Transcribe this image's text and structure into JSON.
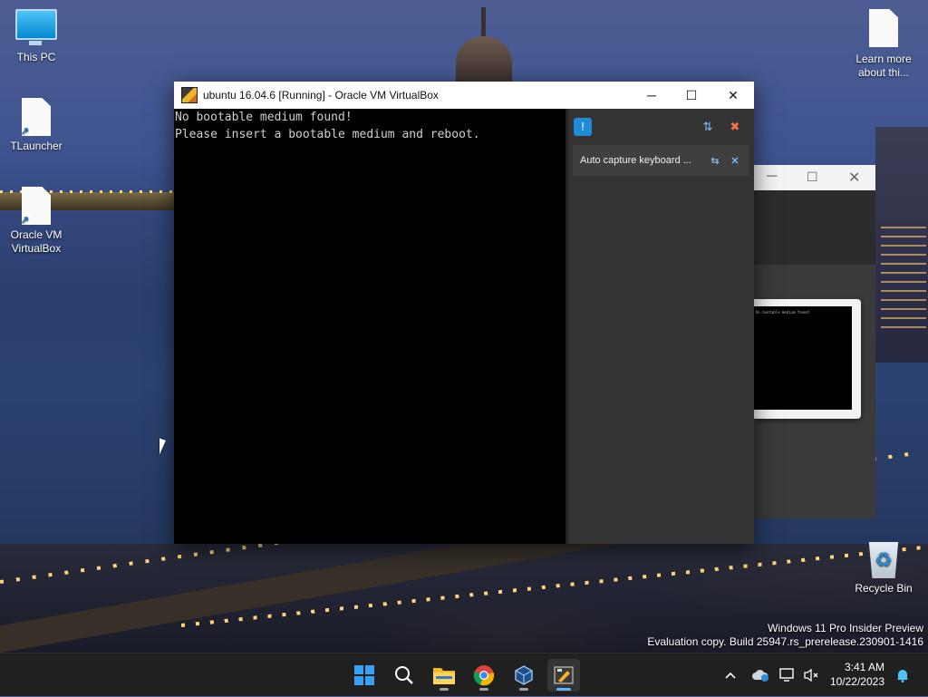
{
  "desktop": {
    "icons": [
      {
        "label": "This PC",
        "icon": "monitor-icon"
      },
      {
        "label": "TLauncher",
        "icon": "file-shortcut-icon"
      },
      {
        "label": "Oracle VM VirtualBox",
        "icon": "file-shortcut-icon"
      },
      {
        "label": "Learn more about thi...",
        "icon": "file-icon"
      },
      {
        "label": "Recycle Bin",
        "icon": "recycle-bin-icon"
      }
    ],
    "watermark": {
      "line1": "Windows 11 Pro Insider Preview",
      "line2": "Evaluation copy. Build 25947.rs_prerelease.230901-1416"
    }
  },
  "vbox_window": {
    "title": "ubuntu 16.04.6 [Running] - Oracle VM VirtualBox",
    "controls": {
      "minimize": "─",
      "maximize": "☐",
      "close": "✕"
    },
    "console_lines": [
      "No bootable medium found!",
      "Please insert a bootable medium and reboot."
    ],
    "notification": {
      "text": "Auto capture keyboard ...",
      "icons": [
        "pin-icon",
        "close-icon"
      ]
    }
  },
  "back_window": {
    "controls": {
      "minimize": "─",
      "maximize": "☐",
      "close": "✕"
    },
    "thumb_text": "No bootable medium found!"
  },
  "taskbar": {
    "apps": [
      {
        "name": "start-button",
        "icon": "windows-logo-icon"
      },
      {
        "name": "search-button",
        "icon": "search-icon"
      },
      {
        "name": "file-explorer",
        "icon": "folder-icon"
      },
      {
        "name": "chrome",
        "icon": "chrome-icon"
      },
      {
        "name": "virtualbox-manager",
        "icon": "virtualbox-icon"
      },
      {
        "name": "virtualbox-vm",
        "icon": "vm-window-icon"
      }
    ],
    "clock": {
      "time": "3:41 AM",
      "date": "10/22/2023"
    }
  },
  "colors": {
    "taskbar_bg": "#202020",
    "accent": "#5fb3f6",
    "vm_panel": "#333333"
  }
}
